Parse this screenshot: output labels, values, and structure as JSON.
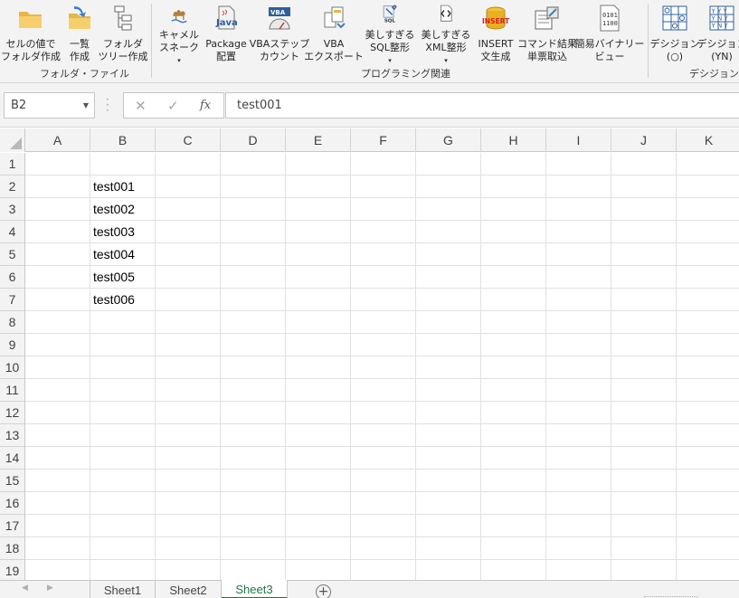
{
  "ribbon": {
    "buttons": [
      {
        "id": "cell-to-folder",
        "line1": "セルの値で",
        "line2": "フォルダ作成",
        "icon": "folder-icon"
      },
      {
        "id": "batch-create",
        "line1": "一覧",
        "line2": "作成",
        "icon": "folder-arrow-icon"
      },
      {
        "id": "folder-tree",
        "line1": "フォルダ",
        "line2": "ツリー作成",
        "icon": "tree-icon"
      },
      {
        "id": "camel-snake",
        "line1": "キャメル",
        "line2": "スネーク",
        "icon": "camel-icon",
        "dropdown": true
      },
      {
        "id": "package",
        "line1": "Package",
        "line2": "配置",
        "icon": "java-icon"
      },
      {
        "id": "vba-step",
        "line1": "VBAステップ",
        "line2": "カウント",
        "icon": "vba-gauge-icon"
      },
      {
        "id": "vba-export",
        "line1": "VBA",
        "line2": "エクスポート",
        "icon": "vba-export-icon"
      },
      {
        "id": "sql-format",
        "line1": "美しすぎる",
        "line2": "SQL整形",
        "icon": "sql-icon",
        "dropdown": true
      },
      {
        "id": "xml-format",
        "line1": "美しすぎる",
        "line2": "XML整形",
        "icon": "xml-icon",
        "dropdown": true
      },
      {
        "id": "insert-gen",
        "line1": "INSERT",
        "line2": "文生成",
        "icon": "insert-db-icon"
      },
      {
        "id": "cmd-result",
        "line1": "コマンド結果",
        "line2": "単票取込",
        "icon": "command-sheet-icon"
      },
      {
        "id": "binary-view",
        "line1": "簡易バイナリー",
        "line2": "ビュー",
        "icon": "binary-icon"
      },
      {
        "id": "decision-o",
        "line1": "デシジョン",
        "line2": "(○)",
        "icon": "decision-circle-icon"
      },
      {
        "id": "decision-yn",
        "line1": "デシジョン",
        "line2": "(YN)",
        "icon": "decision-yn-icon"
      }
    ],
    "groups": [
      {
        "id": "folder-file",
        "label": "フォルダ・ファイル"
      },
      {
        "id": "programming",
        "label": "プログラミング関連"
      },
      {
        "id": "decision",
        "label": "デシジョン表"
      }
    ],
    "dropdown_caret": "▾"
  },
  "formula_bar": {
    "name_box": "B2",
    "cancel": "✕",
    "enter": "✓",
    "fx": "fx",
    "content": "test001"
  },
  "grid": {
    "columns": [
      "A",
      "B",
      "C",
      "D",
      "E",
      "F",
      "G",
      "H",
      "I",
      "J",
      "K"
    ],
    "rows": [
      "1",
      "2",
      "3",
      "4",
      "5",
      "6",
      "7",
      "8",
      "9",
      "10",
      "11",
      "12",
      "13",
      "14",
      "15",
      "16",
      "17",
      "18",
      "19"
    ],
    "cells": [
      {
        "ref": "B2",
        "value": "test001"
      },
      {
        "ref": "B3",
        "value": "test002"
      },
      {
        "ref": "B4",
        "value": "test003"
      },
      {
        "ref": "B5",
        "value": "test004"
      },
      {
        "ref": "B6",
        "value": "test005"
      },
      {
        "ref": "B7",
        "value": "test006"
      }
    ]
  },
  "sheets": {
    "tabs": [
      "Sheet1",
      "Sheet2",
      "Sheet3"
    ],
    "active": "Sheet3",
    "add_label": "+",
    "prev": "◀",
    "next": "▶"
  },
  "colors": {
    "accent": "#217346",
    "ribbon_bg": "#f3f3f3",
    "grid_line": "#e1e1e1"
  }
}
